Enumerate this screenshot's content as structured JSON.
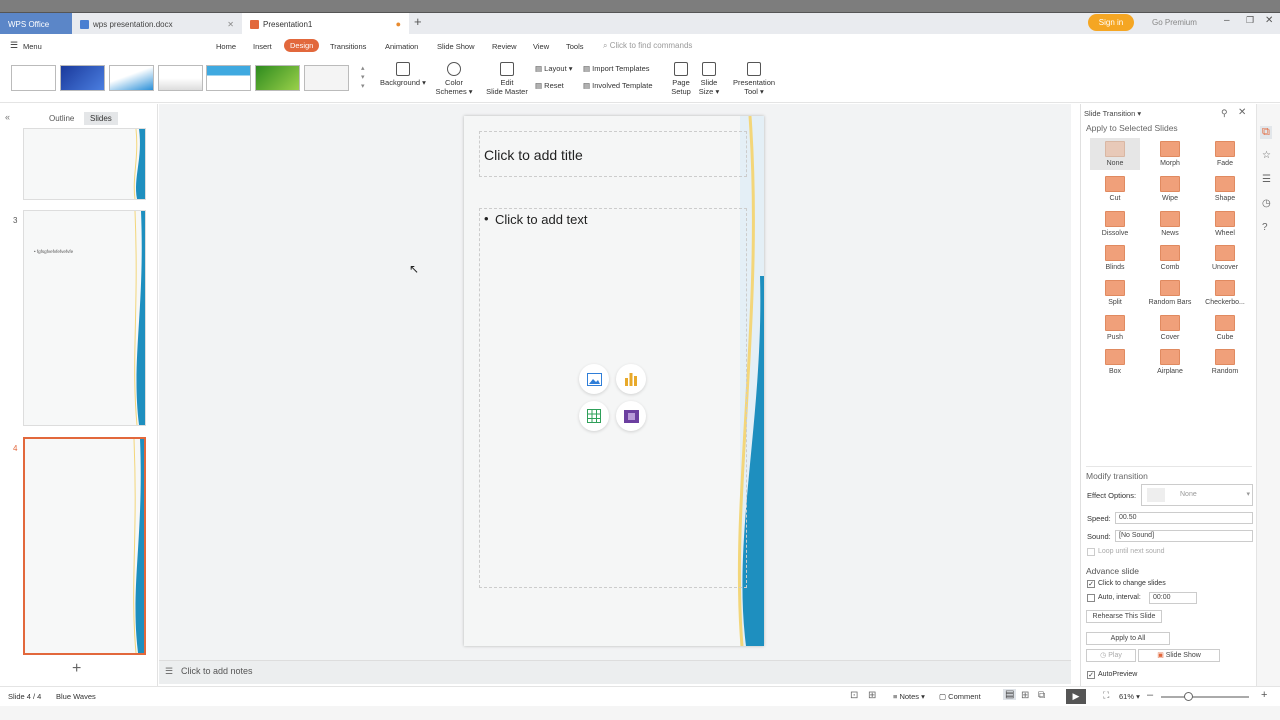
{
  "tabs": {
    "wps": "WPS Office",
    "doc": "wps presentation.docx",
    "ppt": "Presentation1"
  },
  "header": {
    "sign_in": "Sign in",
    "go_premium": "Go Premium"
  },
  "menu": {
    "menu_label": "Menu",
    "items": [
      "Home",
      "Insert",
      "Design",
      "Transitions",
      "Animation",
      "Slide Show",
      "Review",
      "View",
      "Tools"
    ],
    "active": "Design",
    "search_placeholder": "Click to find commands"
  },
  "ribbon": {
    "background": "Background",
    "color_schemes_1": "Color",
    "color_schemes_2": "Schemes",
    "edit_master_1": "Edit",
    "edit_master_2": "Slide Master",
    "layout": "Layout",
    "reset": "Reset",
    "import_templates": "Import Templates",
    "involved_template": "Involved Template",
    "page_setup_1": "Page",
    "page_setup_2": "Setup",
    "slide_size_1": "Slide",
    "slide_size_2": "Size",
    "presentation_tool_1": "Presentation",
    "presentation_tool_2": "Tool"
  },
  "left_panel": {
    "tab_outline": "Outline",
    "tab_slides": "Slides",
    "slide3_number": "3",
    "slide3_text": "• fgfsgfvefvfefvefvfe",
    "slide4_number": "4"
  },
  "slide": {
    "title_placeholder": "Click to add title",
    "text_placeholder": "Click to add text"
  },
  "notes": {
    "placeholder": "Click to add notes"
  },
  "transition_panel": {
    "title": "Slide Transition",
    "apply_label": "Apply to Selected Slides",
    "transitions": [
      "None",
      "Morph",
      "Fade",
      "Cut",
      "Wipe",
      "Shape",
      "Dissolve",
      "News",
      "Wheel",
      "Blinds",
      "Comb",
      "Uncover",
      "Split",
      "Random Bars",
      "Checkerbo...",
      "Push",
      "Cover",
      "Cube",
      "Box",
      "Airplane",
      "Random"
    ],
    "modify_label": "Modify transition",
    "effect_options_label": "Effect Options:",
    "effect_options_value": "None",
    "speed_label": "Speed:",
    "speed_value": "00.50",
    "sound_label": "Sound:",
    "sound_value": "[No Sound]",
    "loop_label": "Loop until next sound",
    "advance_label": "Advance slide",
    "click_to_change": "Click to change slides",
    "auto_interval": "Auto, interval:",
    "interval_value": "00:00",
    "rehearse": "Rehearse This Slide",
    "apply_all": "Apply to All",
    "play": "Play",
    "slide_show": "Slide Show",
    "autopreview": "AutoPreview"
  },
  "status": {
    "slide_count": "Slide 4 / 4",
    "theme": "Blue Waves",
    "notes": "Notes",
    "comment": "Comment",
    "zoom": "61%"
  },
  "colors": {
    "accent": "#e2683c",
    "wps_tab": "#5b86c8",
    "sign_in": "#f5a623",
    "selected_slide_border": "#e2683c"
  }
}
